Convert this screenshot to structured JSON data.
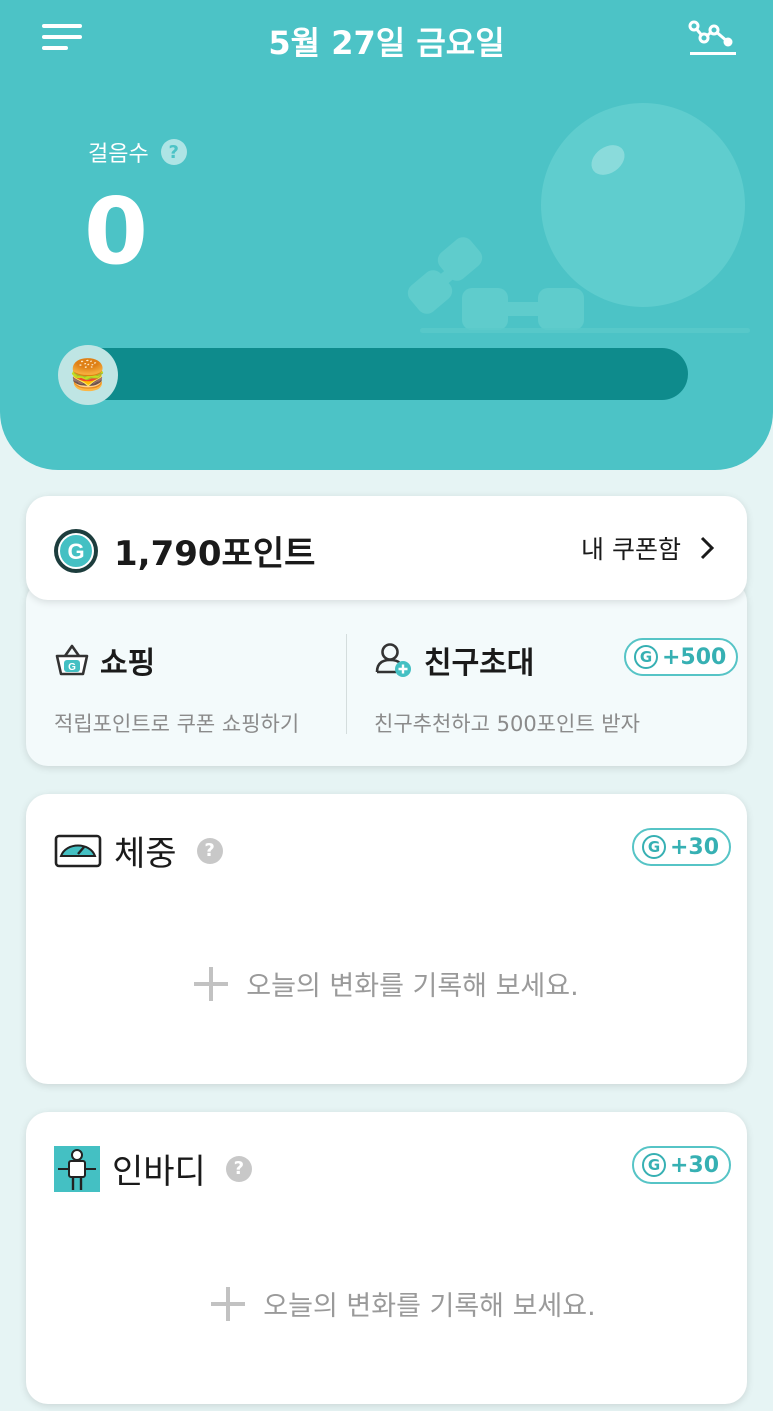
{
  "header": {
    "date_title": "5월 27일 금요일",
    "menu_icon": "hamburger-menu-icon",
    "graph_icon": "trend-graph-icon"
  },
  "steps": {
    "label": "걸음수",
    "help_mark": "?",
    "value": "0",
    "progress_fraction": 0.0,
    "goal_icon": "burger-icon",
    "goal_emoji": "🍔"
  },
  "points": {
    "amount": "1,790포인트",
    "coupon_link": "내 쿠폰함",
    "coupon_chevron": "›"
  },
  "shopping": {
    "title": "쇼핑",
    "subtitle": "적립포인트로 쿠폰 쇼핑하기",
    "icon": "shopping-basket-icon",
    "icon_letter": "G"
  },
  "invite": {
    "title": "친구초대",
    "subtitle": "친구추천하고 500포인트 받자",
    "icon": "add-friend-icon",
    "badge_coin": "G",
    "badge": "+500"
  },
  "weight": {
    "title": "체중",
    "help_mark": "?",
    "icon": "scale-icon",
    "badge_coin": "G",
    "badge": "+30",
    "add_text": "오늘의 변화를 기록해 보세요."
  },
  "inbody": {
    "title": "인바디",
    "help_mark": "?",
    "icon": "body-composition-icon",
    "badge_coin": "G",
    "badge": "+30",
    "add_text": "오늘의 변화를 기록해 보세요."
  },
  "colors": {
    "primary": "#4cc3c6",
    "progress_track": "#0e8b8c",
    "badge": "#36b0b3",
    "background": "#e6f4f4"
  }
}
